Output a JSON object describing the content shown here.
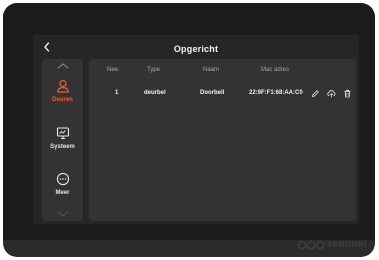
{
  "header": {
    "title": "Opgericht",
    "back_icon": "chevron-left-icon"
  },
  "sidebar": {
    "items": [
      {
        "label": "Deuren",
        "icon": "user-icon",
        "active": true
      },
      {
        "label": "Systeem",
        "icon": "monitor-icon",
        "active": false
      },
      {
        "label": "Meer",
        "icon": "more-icon",
        "active": false
      }
    ],
    "scroll_up_icon": "chevron-up-icon",
    "scroll_down_icon": "chevron-down-icon"
  },
  "table": {
    "columns": [
      "Nee.",
      "Type",
      "Naam",
      "Mac adres"
    ],
    "rows": [
      {
        "nee": "1",
        "type": "deurbel",
        "naam": "Doorbell",
        "mac": "22:9F:F1:68:AA:C0"
      }
    ],
    "actions": [
      "edit-icon",
      "upload-icon",
      "trash-icon"
    ]
  },
  "device": {
    "brand": "sentinel"
  },
  "colors": {
    "accent": "#e8622a",
    "screen_bg": "#262628",
    "panel_bg": "#333336",
    "bezel": "#1b1b1b"
  }
}
